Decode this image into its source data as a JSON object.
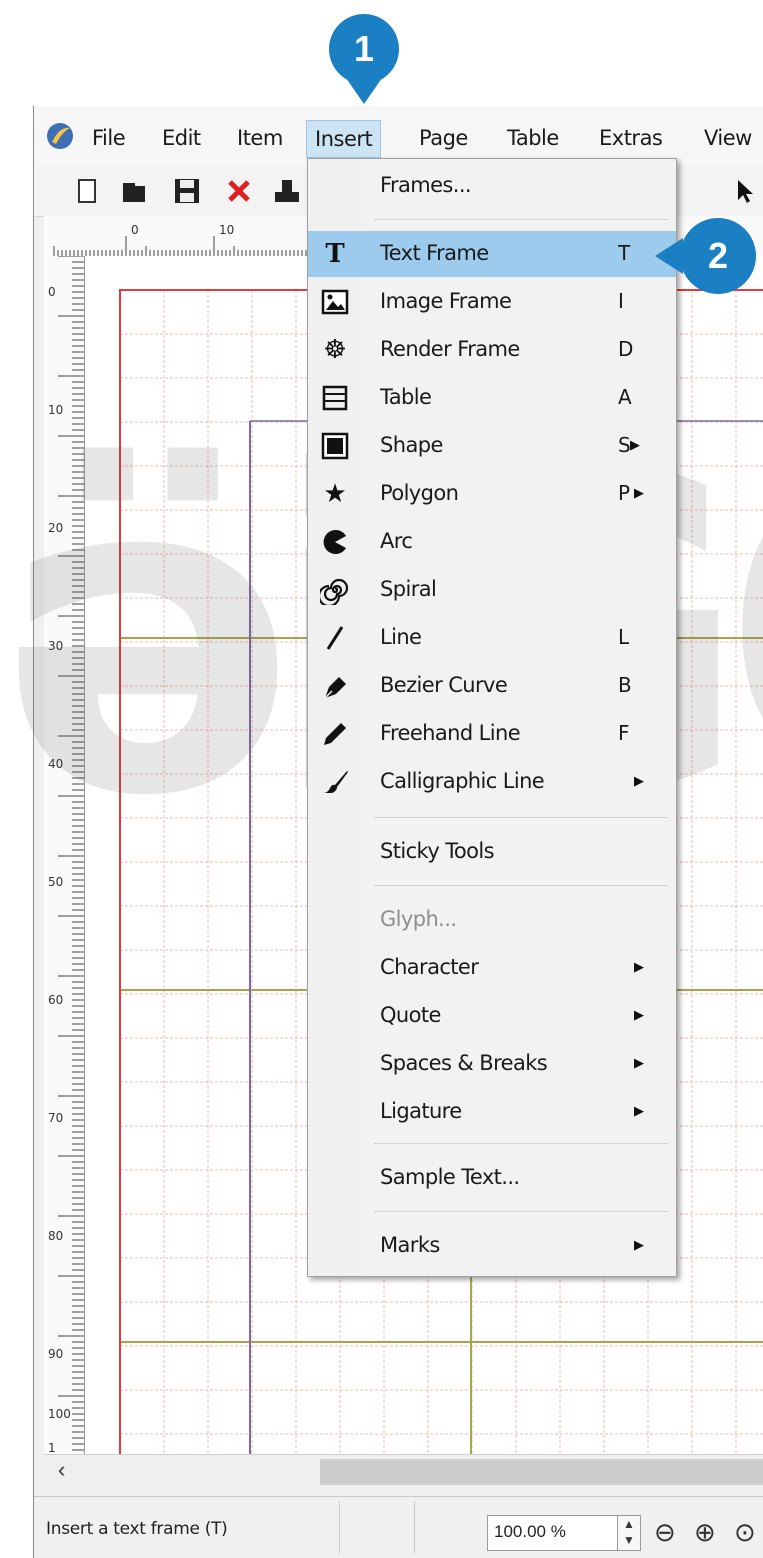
{
  "callouts": {
    "step1": "1",
    "step2": "2"
  },
  "menubar": {
    "items": [
      "File",
      "Edit",
      "Item",
      "Insert",
      "Page",
      "Table",
      "Extras",
      "View"
    ],
    "active": "Insert"
  },
  "toolbar": {
    "icons": [
      "new-document-icon",
      "open-folder-icon",
      "save-icon",
      "close-icon",
      "print-icon",
      "select-pointer-icon"
    ]
  },
  "ruler_top": {
    "labels": [
      "0",
      "10"
    ]
  },
  "ruler_left": {
    "labels": [
      "0",
      "10",
      "20",
      "30",
      "40",
      "50",
      "60",
      "70",
      "80",
      "90",
      "100",
      "1"
    ]
  },
  "insert_menu": {
    "items": [
      {
        "label": "Frames...",
        "shortcut": "",
        "icon": "",
        "submenu": false,
        "disabled": false
      },
      {
        "label": "Text Frame",
        "shortcut": "T",
        "icon": "text-frame-icon",
        "submenu": false,
        "disabled": false,
        "highlighted": true
      },
      {
        "label": "Image Frame",
        "shortcut": "I",
        "icon": "image-frame-icon",
        "submenu": false,
        "disabled": false
      },
      {
        "label": "Render Frame",
        "shortcut": "D",
        "icon": "render-frame-icon",
        "submenu": false,
        "disabled": false
      },
      {
        "label": "Table",
        "shortcut": "A",
        "icon": "table-icon",
        "submenu": false,
        "disabled": false
      },
      {
        "label": "Shape",
        "shortcut": "S",
        "icon": "shape-icon",
        "submenu": true,
        "disabled": false
      },
      {
        "label": "Polygon",
        "shortcut": "P",
        "icon": "polygon-star-icon",
        "submenu": true,
        "disabled": false
      },
      {
        "label": "Arc",
        "shortcut": "",
        "icon": "arc-icon",
        "submenu": false,
        "disabled": false
      },
      {
        "label": "Spiral",
        "shortcut": "",
        "icon": "spiral-icon",
        "submenu": false,
        "disabled": false
      },
      {
        "label": "Line",
        "shortcut": "L",
        "icon": "line-icon",
        "submenu": false,
        "disabled": false
      },
      {
        "label": "Bezier Curve",
        "shortcut": "B",
        "icon": "bezier-pen-icon",
        "submenu": false,
        "disabled": false
      },
      {
        "label": "Freehand Line",
        "shortcut": "F",
        "icon": "pencil-icon",
        "submenu": false,
        "disabled": false
      },
      {
        "label": "Calligraphic Line",
        "shortcut": "",
        "icon": "brush-icon",
        "submenu": true,
        "disabled": false
      },
      {
        "label": "Sticky Tools",
        "shortcut": "",
        "icon": "",
        "submenu": false,
        "disabled": false
      },
      {
        "label": "Glyph...",
        "shortcut": "",
        "icon": "",
        "submenu": false,
        "disabled": true
      },
      {
        "label": "Character",
        "shortcut": "",
        "icon": "",
        "submenu": true,
        "disabled": false
      },
      {
        "label": "Quote",
        "shortcut": "",
        "icon": "",
        "submenu": true,
        "disabled": false
      },
      {
        "label": "Spaces & Breaks",
        "shortcut": "",
        "icon": "",
        "submenu": true,
        "disabled": false
      },
      {
        "label": "Ligature",
        "shortcut": "",
        "icon": "",
        "submenu": true,
        "disabled": false
      },
      {
        "label": "Sample Text...",
        "shortcut": "",
        "icon": "",
        "submenu": false,
        "disabled": false
      },
      {
        "label": "Marks",
        "shortcut": "",
        "icon": "",
        "submenu": true,
        "disabled": false
      }
    ]
  },
  "statusbar": {
    "message": "Insert a text frame (T)",
    "zoom_value": "100.00 %",
    "zoom_icons": [
      "zoom-out-icon",
      "zoom-in-icon"
    ]
  },
  "colors": {
    "callout": "#1b7fc4",
    "menu_highlight": "#9ccbee",
    "grid_minor": "#f2b8b0",
    "margin_red": "#e23b3b",
    "guide_olive": "#a7a74a",
    "guide_purple": "#7c6aa8"
  }
}
